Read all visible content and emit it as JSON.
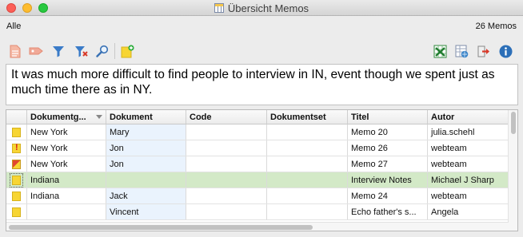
{
  "window": {
    "title": "Übersicht Memos"
  },
  "filter_label": "Alle",
  "count_label": "26 Memos",
  "toolbar": {
    "left": [
      "new-memo-icon",
      "tag-icon",
      "filter-icon",
      "clear-filter-icon",
      "search-icon",
      "add-memo-icon"
    ],
    "right": [
      "excel-export-icon",
      "web-export-icon",
      "export-icon",
      "info-icon"
    ]
  },
  "memo_text": "It was much more difficult to find people to interview in IN, event though we spent just as much time there as in NY.",
  "table": {
    "columns": [
      "",
      "Dokumentg...",
      "Dokument",
      "Code",
      "Dokumentset",
      "Titel",
      "Autor"
    ],
    "rows": [
      {
        "icon": "memo-yellow",
        "cells": [
          "New York",
          "Mary",
          "",
          "",
          "Memo 20",
          "julia.schehl"
        ]
      },
      {
        "icon": "memo-exclamation",
        "cells": [
          "New York",
          "Jon",
          "",
          "",
          "Memo 26",
          "webteam"
        ]
      },
      {
        "icon": "memo-triangle",
        "cells": [
          "New York",
          "Jon",
          "",
          "",
          "Memo 27",
          "webteam"
        ]
      },
      {
        "icon": "memo-yellow",
        "cells": [
          "Indiana",
          "",
          "",
          "",
          "Interview Notes",
          "Michael J Sharp"
        ],
        "selected": true
      },
      {
        "icon": "memo-yellow",
        "cells": [
          "Indiana",
          "Jack",
          "",
          "",
          "Memo 24",
          "webteam"
        ]
      },
      {
        "icon": "memo-yellow",
        "cells": [
          "",
          "Vincent",
          "",
          "",
          "Echo father's s...",
          "Angela"
        ]
      }
    ]
  },
  "colors": {
    "selected_row": "#d3e9c7",
    "document_column": "#eaf3fd",
    "memo_yellow": "#f7d533"
  }
}
